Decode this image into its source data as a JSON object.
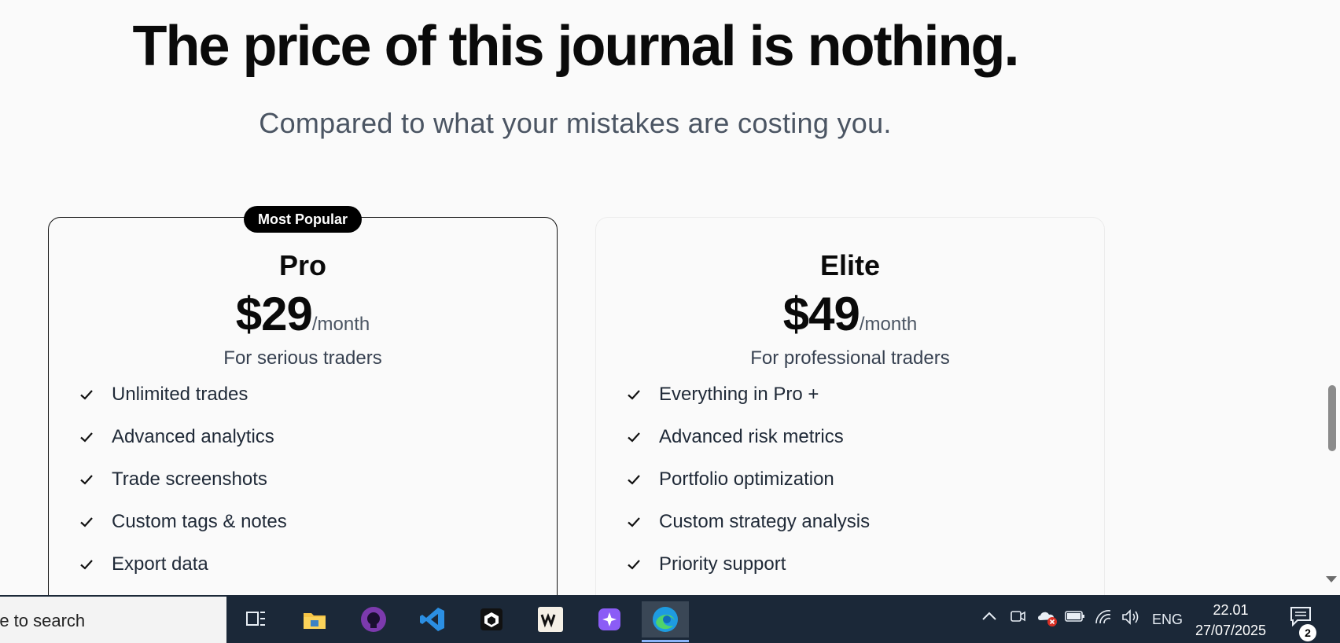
{
  "hero": {
    "title": "The price of this journal is nothing.",
    "subtitle": "Compared to what your mistakes are costing you."
  },
  "plans": [
    {
      "badge": "Most Popular",
      "name": "Pro",
      "price": "$29",
      "period": "/month",
      "tagline": "For serious traders",
      "features": [
        "Unlimited trades",
        "Advanced analytics",
        "Trade screenshots",
        "Custom tags & notes",
        "Export data"
      ]
    },
    {
      "name": "Elite",
      "price": "$49",
      "period": "/month",
      "tagline": "For professional traders",
      "features": [
        "Everything in Pro +",
        "Advanced risk metrics",
        "Portfolio optimization",
        "Custom strategy analysis",
        "Priority support"
      ]
    }
  ],
  "taskbar": {
    "search_text": "re to search",
    "apps": [
      "task-view-icon",
      "file-explorer-icon",
      "github-desktop-icon",
      "vscode-icon",
      "app-cube-icon",
      "windsurf-icon",
      "app-sparkle-icon",
      "edge-icon"
    ],
    "tray": {
      "language": "ENG",
      "time": "22.01",
      "date": "27/07/2025",
      "notification_count": "2"
    }
  },
  "colors": {
    "background": "#fafafa",
    "headline": "#0a0a0a",
    "muted_text": "#4b5563",
    "badge_bg": "#000000",
    "taskbar_bg": "#1b2838"
  }
}
